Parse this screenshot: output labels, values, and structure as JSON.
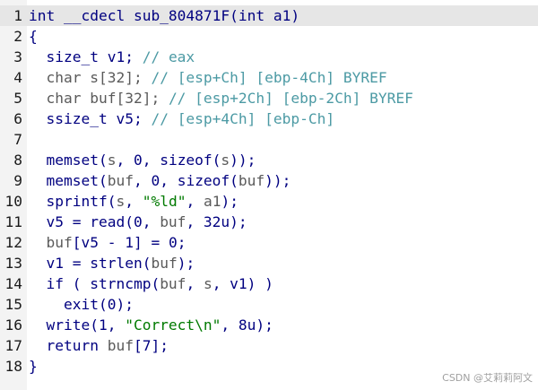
{
  "lines": [
    {
      "num": "1",
      "parts": [
        {
          "t": "int __cdecl sub_804871F(int a1)",
          "c": "kw"
        }
      ],
      "highlight": true
    },
    {
      "num": "2",
      "parts": [
        {
          "t": "{",
          "c": "kw"
        }
      ]
    },
    {
      "num": "3",
      "parts": [
        {
          "t": "  size_t v1; ",
          "c": "kw"
        },
        {
          "t": "// eax",
          "c": "cm"
        }
      ]
    },
    {
      "num": "4",
      "parts": [
        {
          "t": "  char s[32]; ",
          "c": "pl"
        },
        {
          "t": "// [esp+Ch] [ebp-4Ch] BYREF",
          "c": "cm"
        }
      ]
    },
    {
      "num": "5",
      "parts": [
        {
          "t": "  char buf[32]; ",
          "c": "pl"
        },
        {
          "t": "// [esp+2Ch] [ebp-2Ch] BYREF",
          "c": "cm"
        }
      ]
    },
    {
      "num": "6",
      "parts": [
        {
          "t": "  ssize_t v5; ",
          "c": "kw"
        },
        {
          "t": "// [esp+4Ch] [ebp-Ch]",
          "c": "cm"
        }
      ]
    },
    {
      "num": "7",
      "parts": [
        {
          "t": "",
          "c": "kw"
        }
      ]
    },
    {
      "num": "8",
      "parts": [
        {
          "t": "  memset(",
          "c": "kw"
        },
        {
          "t": "s",
          "c": "pl"
        },
        {
          "t": ", 0, sizeof(",
          "c": "kw"
        },
        {
          "t": "s",
          "c": "pl"
        },
        {
          "t": "));",
          "c": "kw"
        }
      ]
    },
    {
      "num": "9",
      "parts": [
        {
          "t": "  memset(",
          "c": "kw"
        },
        {
          "t": "buf",
          "c": "pl"
        },
        {
          "t": ", 0, sizeof(",
          "c": "kw"
        },
        {
          "t": "buf",
          "c": "pl"
        },
        {
          "t": "));",
          "c": "kw"
        }
      ]
    },
    {
      "num": "10",
      "parts": [
        {
          "t": "  sprintf(",
          "c": "kw"
        },
        {
          "t": "s",
          "c": "pl"
        },
        {
          "t": ", ",
          "c": "kw"
        },
        {
          "t": "\"%ld\"",
          "c": "st"
        },
        {
          "t": ", ",
          "c": "kw"
        },
        {
          "t": "a1",
          "c": "pl"
        },
        {
          "t": ");",
          "c": "kw"
        }
      ]
    },
    {
      "num": "11",
      "parts": [
        {
          "t": "  v5 = read(0, ",
          "c": "kw"
        },
        {
          "t": "buf",
          "c": "pl"
        },
        {
          "t": ", 32u);",
          "c": "kw"
        }
      ]
    },
    {
      "num": "12",
      "parts": [
        {
          "t": "  ",
          "c": "kw"
        },
        {
          "t": "buf",
          "c": "pl"
        },
        {
          "t": "[v5 - 1] = 0;",
          "c": "kw"
        }
      ]
    },
    {
      "num": "13",
      "parts": [
        {
          "t": "  v1 = strlen(",
          "c": "kw"
        },
        {
          "t": "buf",
          "c": "pl"
        },
        {
          "t": ");",
          "c": "kw"
        }
      ]
    },
    {
      "num": "14",
      "parts": [
        {
          "t": "  if ( strncmp(",
          "c": "kw"
        },
        {
          "t": "buf",
          "c": "pl"
        },
        {
          "t": ", ",
          "c": "kw"
        },
        {
          "t": "s",
          "c": "pl"
        },
        {
          "t": ", v1) )",
          "c": "kw"
        }
      ]
    },
    {
      "num": "15",
      "parts": [
        {
          "t": "    exit(0);",
          "c": "kw"
        }
      ]
    },
    {
      "num": "16",
      "parts": [
        {
          "t": "  write(1, ",
          "c": "kw"
        },
        {
          "t": "\"Correct\\n\"",
          "c": "st"
        },
        {
          "t": ", 8u);",
          "c": "kw"
        }
      ]
    },
    {
      "num": "17",
      "parts": [
        {
          "t": "  return ",
          "c": "kw"
        },
        {
          "t": "buf",
          "c": "pl"
        },
        {
          "t": "[7];",
          "c": "kw"
        }
      ]
    },
    {
      "num": "18",
      "parts": [
        {
          "t": "}",
          "c": "kw"
        }
      ]
    }
  ],
  "watermark": "CSDN @艾莉莉阿文",
  "colors": {
    "keyword": "#000080",
    "comment": "#4c9aa4",
    "plain": "#5a5a5a",
    "string": "#007a00",
    "highlight": "#e6e6e6",
    "gutter": "#f3f3f3"
  }
}
